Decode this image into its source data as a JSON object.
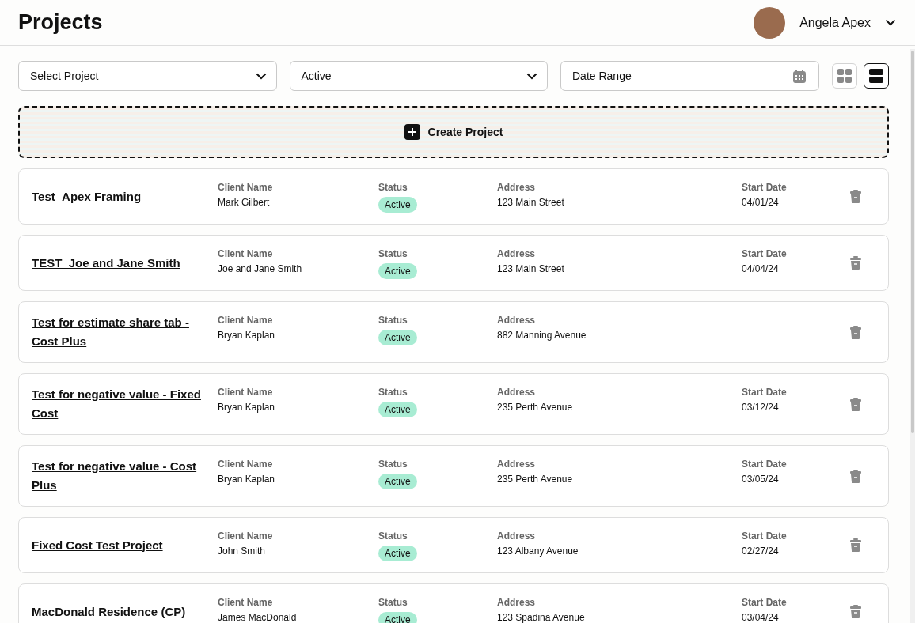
{
  "header": {
    "title": "Projects",
    "user_name": "Angela Apex"
  },
  "filters": {
    "project_select": "Select Project",
    "status_select": "Active",
    "date_range": {
      "placeholder": "Date Range"
    },
    "view_toggle": [
      {
        "kind": "grid",
        "selected": false
      },
      {
        "kind": "list",
        "selected": true
      }
    ]
  },
  "create_button": "Create Project",
  "projects": [
    {
      "name": "Test_Apex Framing",
      "client_label": "Client Name",
      "client": "Mark Gilbert",
      "status_label": "Status",
      "status": "Active",
      "address_label": "Address",
      "address": "123 Main Street",
      "start_label": "Start Date",
      "start_date": "04/01/24"
    },
    {
      "name": "TEST_Joe and Jane Smith",
      "client_label": "Client Name",
      "client": "Joe and Jane Smith",
      "status_label": "Status",
      "status": "Active",
      "address_label": "Address",
      "address": "123 Main Street",
      "start_label": "Start Date",
      "start_date": "04/04/24"
    },
    {
      "name": "Test for estimate share tab - Cost Plus",
      "client_label": "Client Name",
      "client": "Bryan Kaplan",
      "status_label": "Status",
      "status": "Active",
      "address_label": "Address",
      "address": "882 Manning Avenue"
    },
    {
      "name": "Test for negative value - Fixed Cost",
      "client_label": "Client Name",
      "client": "Bryan Kaplan",
      "status_label": "Status",
      "status": "Active",
      "address_label": "Address",
      "address": "235 Perth Avenue",
      "start_label": "Start Date",
      "start_date": "03/12/24"
    },
    {
      "name": "Test for negative value - Cost Plus",
      "client_label": "Client Name",
      "client": "Bryan Kaplan",
      "status_label": "Status",
      "status": "Active",
      "address_label": "Address",
      "address": "235 Perth Avenue",
      "start_label": "Start Date",
      "start_date": "03/05/24"
    },
    {
      "name": "Fixed Cost Test Project",
      "client_label": "Client Name",
      "client": "John Smith",
      "status_label": "Status",
      "status": "Active",
      "address_label": "Address",
      "address": "123 Albany Avenue",
      "start_label": "Start Date",
      "start_date": "02/27/24"
    },
    {
      "name": "MacDonald Residence (CP)",
      "client_label": "Client Name",
      "client": "James MacDonald",
      "status_label": "Status",
      "status": "Active",
      "address_label": "Address",
      "address": "123 Spadina Avenue",
      "start_label": "Start Date",
      "start_date": "03/04/24"
    }
  ]
}
